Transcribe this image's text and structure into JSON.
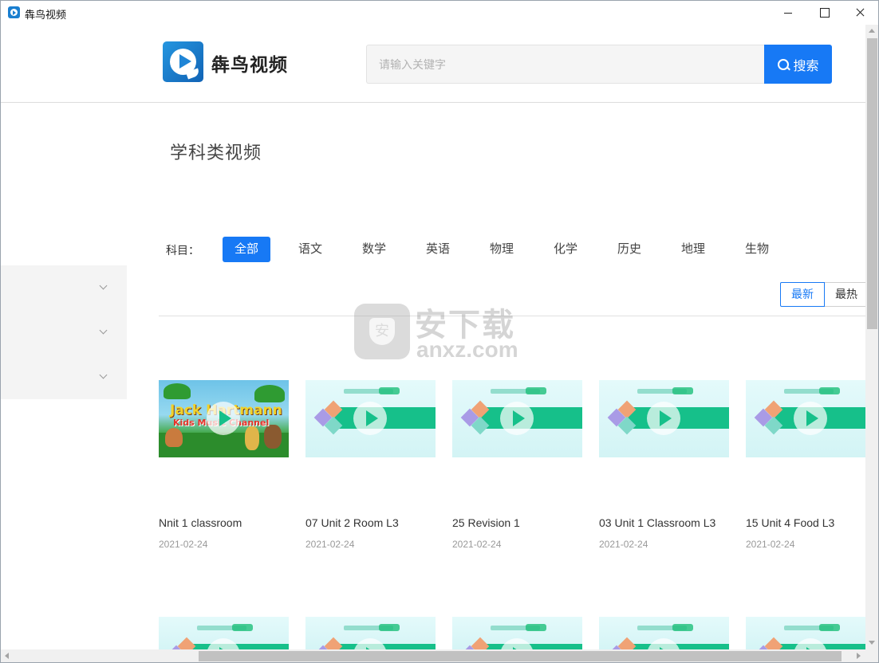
{
  "window": {
    "title": "犇鸟视频"
  },
  "header": {
    "logo_text": "犇鸟视频",
    "search_placeholder": "请输入关键字",
    "search_value": "",
    "search_button_label": "搜索"
  },
  "section_title": "学科类视频",
  "subjects": {
    "label": "科目：",
    "items": [
      {
        "label": "全部",
        "active": true
      },
      {
        "label": "语文",
        "active": false
      },
      {
        "label": "数学",
        "active": false
      },
      {
        "label": "英语",
        "active": false
      },
      {
        "label": "物理",
        "active": false
      },
      {
        "label": "化学",
        "active": false
      },
      {
        "label": "历史",
        "active": false
      },
      {
        "label": "地理",
        "active": false
      },
      {
        "label": "生物",
        "active": false
      }
    ]
  },
  "sort": {
    "latest_label": "最新",
    "hottest_label": "最热"
  },
  "watermark": {
    "text": "安下载",
    "sub": "anxz.com"
  },
  "videos": [
    {
      "title": "Nnit 1 classroom",
      "date": "2021-02-24",
      "thumb": "cartoon"
    },
    {
      "title": "07 Unit 2 Room L3",
      "date": "2021-02-24",
      "thumb": "lesson"
    },
    {
      "title": "25 Revision 1",
      "date": "2021-02-24",
      "thumb": "lesson"
    },
    {
      "title": "03 Unit 1 Classroom L3",
      "date": "2021-02-24",
      "thumb": "lesson"
    },
    {
      "title": "15 Unit 4 Food L3",
      "date": "2021-02-24",
      "thumb": "lesson"
    }
  ],
  "colors": {
    "accent": "#1779f5",
    "lesson_green": "#16c08a"
  }
}
